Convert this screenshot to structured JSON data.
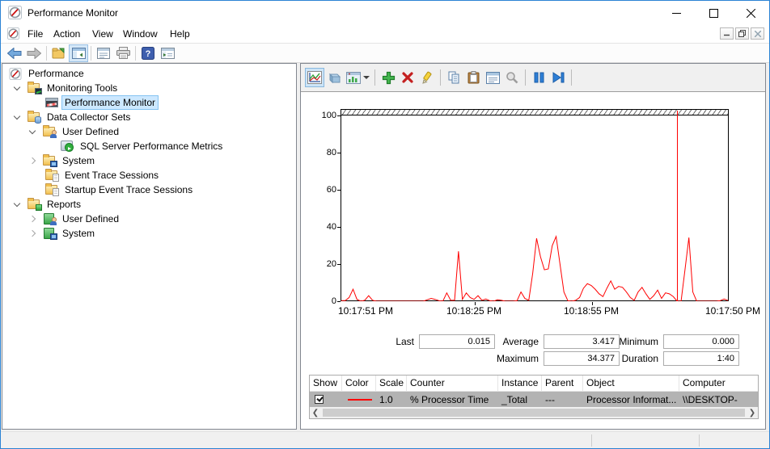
{
  "window": {
    "title": "Performance Monitor"
  },
  "menu": {
    "items": [
      "File",
      "Action",
      "View",
      "Window",
      "Help"
    ]
  },
  "icons": {
    "titlebar": "perfmon-gauge-icon",
    "main_toolbar": [
      "back-icon",
      "forward-icon",
      "export-icon",
      "show-console-tree-icon",
      "properties-icon",
      "print-icon",
      "help-icon",
      "show-window-icon"
    ],
    "chart_toolbar": [
      "view-current-activity-icon",
      "view-log-data-icon",
      "chart-type-icon",
      "add-counter-icon",
      "delete-counter-icon",
      "highlight-icon",
      "copy-properties-icon",
      "paste-counter-list-icon",
      "properties-icon",
      "zoom-icon",
      "freeze-display-icon",
      "update-data-icon"
    ]
  },
  "tree": {
    "items": [
      {
        "label": "Performance",
        "level": 0,
        "expander": "none",
        "icon": "perfmon-gauge-icon",
        "selected": false
      },
      {
        "label": "Monitoring Tools",
        "level": 1,
        "expander": "open",
        "icon": "folder-chart-icon",
        "selected": false
      },
      {
        "label": "Performance Monitor",
        "level": 2,
        "expander": "none",
        "icon": "performance-monitor-icon",
        "selected": true
      },
      {
        "label": "Data Collector Sets",
        "level": 1,
        "expander": "open",
        "icon": "folder-database-icon",
        "selected": false
      },
      {
        "label": "User Defined",
        "level": 2,
        "expander": "open",
        "icon": "folder-user-icon",
        "selected": false
      },
      {
        "label": "SQL Server Performance Metrics",
        "level": 3,
        "expander": "none",
        "icon": "collector-set-play-icon",
        "selected": false
      },
      {
        "label": "System",
        "level": 2,
        "expander": "closed",
        "icon": "folder-computer-icon",
        "selected": false
      },
      {
        "label": "Event Trace Sessions",
        "level": 2,
        "expander": "none",
        "icon": "folder-clipboard-icon",
        "selected": false
      },
      {
        "label": "Startup Event Trace Sessions",
        "level": 2,
        "expander": "none",
        "icon": "folder-clipboard-icon",
        "selected": false
      },
      {
        "label": "Reports",
        "level": 1,
        "expander": "open",
        "icon": "folder-report-icon",
        "selected": false
      },
      {
        "label": "User Defined",
        "level": 2,
        "expander": "closed",
        "icon": "report-user-icon",
        "selected": false
      },
      {
        "label": "System",
        "level": 2,
        "expander": "closed",
        "icon": "report-computer-icon",
        "selected": false
      }
    ]
  },
  "stats": {
    "last_label": "Last",
    "last_value": "0.015",
    "average_label": "Average",
    "average_value": "3.417",
    "minimum_label": "Minimum",
    "minimum_value": "0.000",
    "maximum_label": "Maximum",
    "maximum_value": "34.377",
    "duration_label": "Duration",
    "duration_value": "1:40"
  },
  "legend": {
    "columns": [
      "Show",
      "Color",
      "Scale",
      "Counter",
      "Instance",
      "Parent",
      "Object",
      "Computer"
    ],
    "row": {
      "show": "checked",
      "color": "#ff0000",
      "scale": "1.0",
      "counter": "% Processor Time",
      "instance": "_Total",
      "parent": "---",
      "object": "Processor Informat...",
      "computer": "\\\\DESKTOP-"
    }
  },
  "chart_data": {
    "type": "line",
    "title": "",
    "xlabel": "",
    "ylabel": "",
    "ylim": [
      0,
      100
    ],
    "yticks": [
      "100",
      "80",
      "60",
      "40",
      "20",
      "0"
    ],
    "xticklabels": [
      "10:17:51 PM",
      "10:18:25 PM",
      "10:18:55 PM",
      "10:17:50 PM"
    ],
    "grid": false,
    "legend_position": "bottom-table",
    "marker_index": 86,
    "marker_color": "#ff0000",
    "series": [
      {
        "name": "% Processor Time",
        "color": "#ff0000",
        "values": [
          0.3,
          0.3,
          2,
          6.5,
          1,
          0,
          0.5,
          3,
          0.5,
          0,
          0,
          0,
          0,
          0,
          0,
          0,
          0,
          0,
          0,
          0,
          0,
          0,
          0.8,
          1.5,
          1,
          0.3,
          0,
          4.5,
          0.5,
          0.5,
          27,
          1,
          4.5,
          2,
          1,
          3,
          0.5,
          1.2,
          0.3,
          0,
          0.8,
          0.5,
          0,
          0,
          0,
          0.3,
          5,
          1.5,
          0.5,
          15,
          34,
          24,
          17,
          17.5,
          30,
          35,
          20,
          5,
          0.3,
          0,
          0.5,
          2,
          7,
          9.5,
          8.5,
          6.5,
          4,
          2.5,
          7,
          11,
          6.5,
          8,
          7.5,
          5,
          2,
          0.5,
          5,
          7.5,
          4,
          1,
          3,
          6,
          1.5,
          4.5,
          4,
          2.5,
          0,
          0,
          17,
          34.4,
          5,
          0,
          0,
          0,
          0,
          0,
          0,
          0.3,
          1.2,
          0.4
        ]
      }
    ]
  }
}
